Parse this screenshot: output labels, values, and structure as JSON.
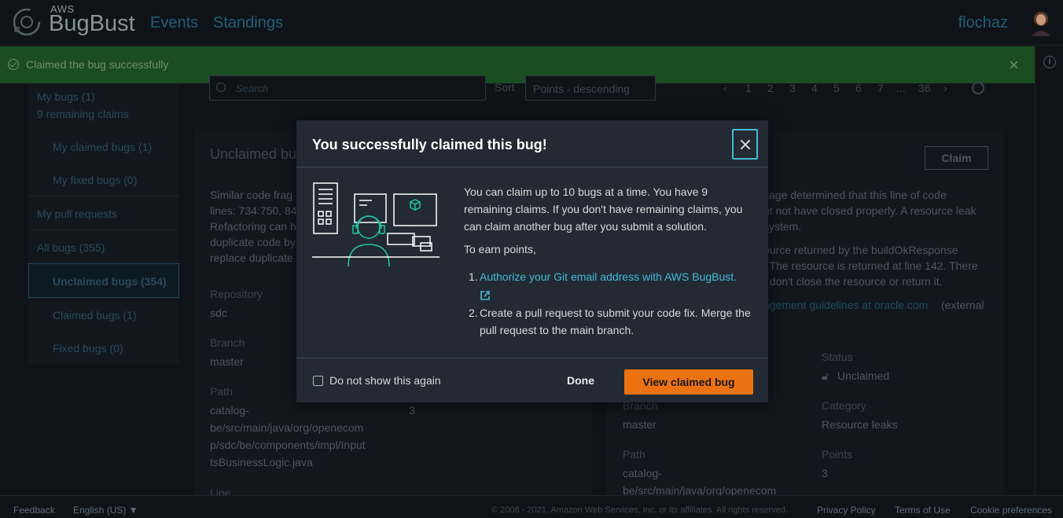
{
  "header": {
    "logo_small": "AWS",
    "logo_big": "BugBust",
    "nav": [
      "Events",
      "Standings"
    ],
    "username": "flochaz"
  },
  "flash": {
    "message": "Claimed the bug successfully",
    "close": "×"
  },
  "sidebar": {
    "items": [
      {
        "label": "My bugs (1)"
      },
      {
        "label": "9 remaining claims"
      },
      {
        "label": "My claimed bugs (1)"
      },
      {
        "label": "My fixed bugs (0)"
      },
      {
        "label": "My pull requests"
      },
      {
        "label": "All bugs (355)"
      },
      {
        "label": "Unclaimed bugs (354)"
      },
      {
        "label": "Claimed bugs (1)"
      },
      {
        "label": "Fixed bugs (0)"
      }
    ]
  },
  "toolbar": {
    "search_placeholder": "Search",
    "sort_label": "Sort",
    "sort_value": "Points - descending",
    "pages": [
      "1",
      "2",
      "3",
      "4",
      "5",
      "6",
      "7",
      "...",
      "36"
    ]
  },
  "card_left": {
    "title": "Unclaimed bu",
    "desc_lines": [
      "Similar code frag",
      "lines: 734:750, 84",
      "Refactoring can h",
      "duplicate code by",
      "replace duplicate"
    ],
    "repository_label": "Repository",
    "repository": "sdc",
    "branch_label": "Branch",
    "branch": "master",
    "path_label": "Path",
    "path_lines": [
      "catalog-",
      "be/src/main/java/org/openecom",
      "p/sdc/be/components/impl/Input",
      "tsBusinessLogic.java"
    ],
    "line_label": "Line",
    "points_partial": "3"
  },
  "card_right": {
    "claim": "Claim",
    "desc_lines": [
      "cage determined that this line of code",
      "nt not have closed properly. A resource leak",
      "system."
    ],
    "desc2_lines": [
      "ource returned by the buildOkResponse",
      ". The resource is returned at line 142. There",
      "t don't close the resource or return it."
    ],
    "link_text": "agement guidelines at oracle.com",
    "link_suffix": "(external",
    "branch_label": "Branch",
    "branch": "master",
    "path_label": "Path",
    "path_lines": [
      "catalog-",
      "be/src/main/java/org/openecom"
    ],
    "status_label": "Status",
    "status": "Unclaimed",
    "category_label": "Category",
    "category": "Resource leaks",
    "points_label": "Points",
    "points": "3"
  },
  "modal": {
    "title": "You successfully claimed this bug!",
    "body": "You can claim up to 10 bugs at a time. You have 9 remaining claims. If you don't have remaining claims, you can claim another bug after you submit a solution.",
    "earn": "To earn points,",
    "step1_num": "1.",
    "step1_link": "Authorize your Git email address with AWS BugBust.",
    "step2_num": "2.",
    "step2_text": "Create a pull request to submit your code fix. Merge the pull request to the main branch.",
    "checkbox_label": "Do not show this again",
    "done": "Done",
    "primary": "View claimed bug"
  },
  "footer": {
    "feedback": "Feedback",
    "language": "English (US) ▼",
    "copyright": "© 2008 - 2021, Amazon Web Services, Inc. or its affiliates. All rights reserved.",
    "privacy": "Privacy Policy",
    "terms": "Terms of Use",
    "cookies": "Cookie preferences"
  },
  "colors": {
    "accent": "#ec7211",
    "link": "#44b9d6",
    "flash": "#1b4d22"
  }
}
